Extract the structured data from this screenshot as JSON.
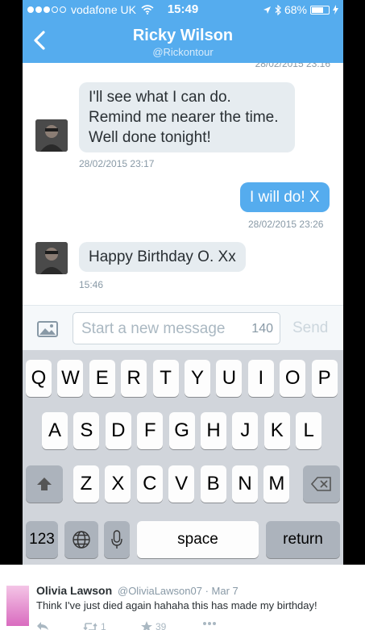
{
  "status": {
    "carrier": "vodafone UK",
    "time": "15:49",
    "battery": "68%",
    "battery_level": 0.68
  },
  "conversation": {
    "title": "Ricky Wilson",
    "handle": "@Rickontour",
    "cut_timestamp": "28/02/2015 23:16",
    "messages": [
      {
        "lines": [
          "I'll see what I can do.",
          "Remind me nearer the time.",
          "Well done tonight!"
        ],
        "timestamp": "28/02/2015 23:17"
      },
      {
        "text": "I will do! X",
        "timestamp": "28/02/2015 23:26"
      },
      {
        "text": "Happy Birthday O. Xx",
        "timestamp": "15:46"
      }
    ]
  },
  "compose": {
    "placeholder": "Start a new message",
    "char_count": "140",
    "send_label": "Send"
  },
  "keyboard": {
    "row1": [
      "Q",
      "W",
      "E",
      "R",
      "T",
      "Y",
      "U",
      "I",
      "O",
      "P"
    ],
    "row2": [
      "A",
      "S",
      "D",
      "F",
      "G",
      "H",
      "J",
      "K",
      "L"
    ],
    "row3": [
      "Z",
      "X",
      "C",
      "V",
      "B",
      "N",
      "M"
    ],
    "numbers_label": "123",
    "space_label": "space",
    "return_label": "return"
  },
  "tweet": {
    "author_name": "Olivia Lawson",
    "author_meta": "@OliviaLawson07 · Mar 7",
    "text": "Think I've just died again hahaha this has made my birthday!",
    "retweets": "1",
    "favorites": "39"
  },
  "colors": {
    "twitter_blue": "#55acee",
    "incoming_bubble": "#e6ecf0",
    "keyboard_bg": "#d1d5db"
  }
}
